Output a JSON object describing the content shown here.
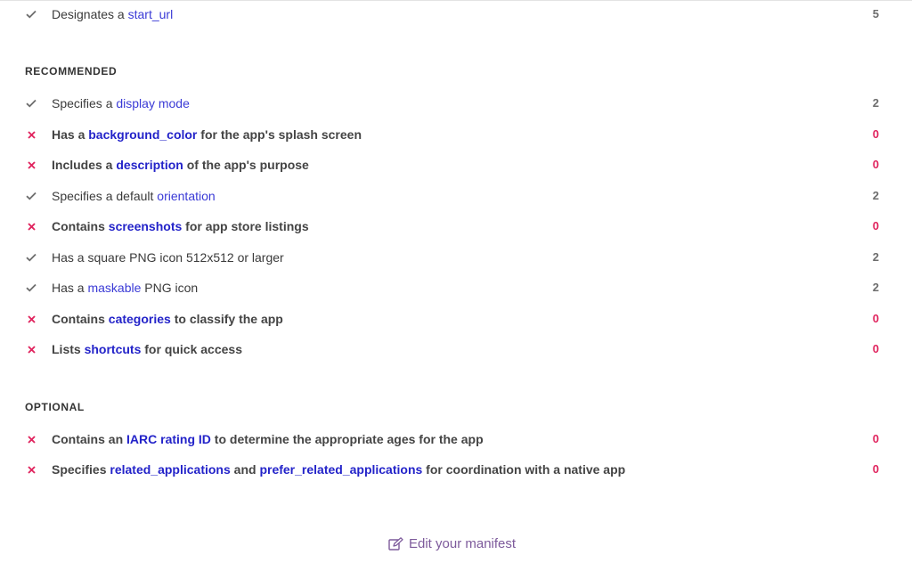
{
  "colors": {
    "pass_icon": "#6d6d6d",
    "fail_icon": "#e0245e",
    "link": "#3a3ad6",
    "edit_link": "#7d5a9b"
  },
  "top_item": {
    "status": "pass",
    "pre": "Designates a ",
    "link": "start_url",
    "post": "",
    "score": "5"
  },
  "recommended": {
    "heading": "RECOMMENDED",
    "items": [
      {
        "status": "pass",
        "pre": "Specifies a ",
        "link": "display mode",
        "post": "",
        "score": "2"
      },
      {
        "status": "fail",
        "pre": "Has a ",
        "link": "background_color",
        "post": " for the app's splash screen",
        "score": "0"
      },
      {
        "status": "fail",
        "pre": "Includes a ",
        "link": "description",
        "post": " of the app's purpose",
        "score": "0"
      },
      {
        "status": "pass",
        "pre": "Specifies a default ",
        "link": "orientation",
        "post": "",
        "score": "2"
      },
      {
        "status": "fail",
        "pre": "Contains ",
        "link": "screenshots",
        "post": " for app store listings",
        "score": "0"
      },
      {
        "status": "pass",
        "pre": "Has a square PNG icon 512x512 or larger",
        "link": "",
        "post": "",
        "score": "2"
      },
      {
        "status": "pass",
        "pre": "Has a ",
        "link": "maskable",
        "post": " PNG icon",
        "score": "2"
      },
      {
        "status": "fail",
        "pre": "Contains ",
        "link": "categories",
        "post": " to classify the app",
        "score": "0"
      },
      {
        "status": "fail",
        "pre": "Lists ",
        "link": "shortcuts",
        "post": " for quick access",
        "score": "0"
      }
    ]
  },
  "optional": {
    "heading": "OPTIONAL",
    "items": [
      {
        "status": "fail",
        "pre": "Contains an ",
        "link": "IARC rating ID",
        "post": " to determine the appropriate ages for the app",
        "score": "0"
      },
      {
        "status": "fail",
        "pre": "Specifies ",
        "link": "related_applications",
        "mid": " and ",
        "link2": "prefer_related_applications",
        "post": " for coordination with a native app",
        "score": "0"
      }
    ]
  },
  "footer": {
    "edit_label": "Edit your manifest",
    "edit_icon": "edit-icon"
  }
}
